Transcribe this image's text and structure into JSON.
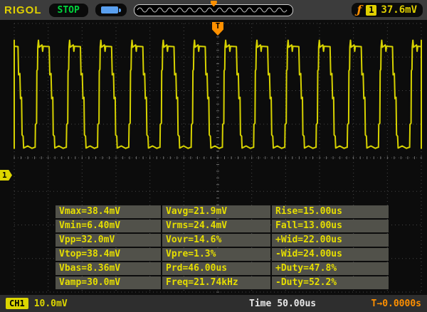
{
  "topbar": {
    "brand": "RIGOL",
    "status": "STOP",
    "trigger_symbol": "ƒ",
    "trigger_channel": "1",
    "trigger_level": "37.6mV"
  },
  "grid": {
    "channel_marker": "1",
    "trigger_marker": "T"
  },
  "measurements": {
    "rows": [
      [
        "Vmax=38.4mV",
        "Vavg=21.9mV",
        "Rise=15.00us"
      ],
      [
        "Vmin=6.40mV",
        "Vrms=24.4mV",
        "Fall=13.00us"
      ],
      [
        "Vpp=32.0mV",
        "Vovr=14.6%",
        "+Wid=22.00us"
      ],
      [
        "Vtop=38.4mV",
        "Vpre=1.3%",
        "-Wid=24.00us"
      ],
      [
        "Vbas=8.36mV",
        "Prd=46.00us",
        "+Duty=47.8%"
      ],
      [
        "Vamp=30.0mV",
        "Freq=21.74kHz",
        "-Duty=52.2%"
      ]
    ]
  },
  "bottombar": {
    "channel_label": "CH1",
    "channel_scale": "10.0mV",
    "time_label": "Time",
    "time_value": "50.00us",
    "trigger_offset": "T→0.0000s"
  },
  "waveform": {
    "color": "#d6d200",
    "volts_per_div_mv": 10,
    "time_per_div_us": 50,
    "period_us": 46,
    "high_mv": 38.4,
    "low_mv": 6.4,
    "period_shape": [
      [
        0.0,
        8.4
      ],
      [
        0.02,
        8.4
      ],
      [
        0.03,
        15.2
      ],
      [
        0.065,
        15.6
      ],
      [
        0.075,
        31.2
      ],
      [
        0.095,
        31.6
      ],
      [
        0.105,
        38.3
      ],
      [
        0.125,
        40.3
      ],
      [
        0.145,
        38.2
      ],
      [
        0.24,
        38.9
      ],
      [
        0.26,
        37.0
      ],
      [
        0.28,
        38.5
      ],
      [
        0.47,
        38.4
      ],
      [
        0.49,
        30.0
      ],
      [
        0.53,
        30.4
      ],
      [
        0.55,
        22.9
      ],
      [
        0.585,
        23.3
      ],
      [
        0.6,
        12.1
      ],
      [
        0.635,
        11.7
      ],
      [
        0.65,
        8.2
      ],
      [
        0.78,
        8.8
      ],
      [
        0.92,
        8.1
      ],
      [
        1.0,
        8.4
      ]
    ]
  }
}
